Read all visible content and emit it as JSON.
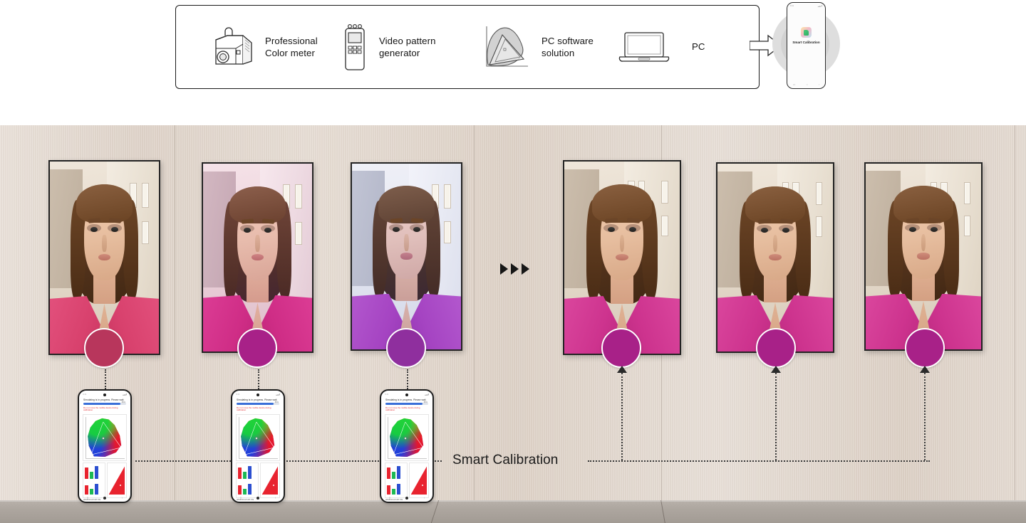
{
  "top_diagram": {
    "equipment": [
      {
        "id": "color-meter",
        "icon": "color-meter-icon",
        "label": "Professional\nColor meter"
      },
      {
        "id": "pattern-generator",
        "icon": "pattern-generator-icon",
        "label": "Video pattern\ngenerator"
      },
      {
        "id": "pc-software",
        "icon": "cie-gamut-icon",
        "label": "PC software\nsolution"
      },
      {
        "id": "pc",
        "icon": "laptop-icon",
        "label": "PC"
      }
    ],
    "flow_arrow_icon": "right-arrow-icon",
    "hero_phone": {
      "status_left": "9:41",
      "status_right": "",
      "app_icon": "smart-calibration-app-icon",
      "app_label": "Smart\nCalibration",
      "nav": [
        "□",
        "○",
        "‹"
      ]
    }
  },
  "scene": {
    "flow_arrows_icon": "triple-play-arrows-icon",
    "caption": "Smart Calibration",
    "uncalibrated_displays": [
      {
        "id": "display-1",
        "swatch_color": "#b8365c",
        "tint": "none",
        "label": "uncalibrated-display-1"
      },
      {
        "id": "display-2",
        "swatch_color": "#a82188",
        "tint": "magenta",
        "label": "uncalibrated-display-2"
      },
      {
        "id": "display-3",
        "swatch_color": "#8f2f9e",
        "tint": "purple",
        "label": "uncalibrated-display-3"
      }
    ],
    "calibrated_displays": [
      {
        "id": "display-4",
        "swatch_color": "#a82188",
        "label": "calibrated-display-1"
      },
      {
        "id": "display-5",
        "swatch_color": "#a82188",
        "label": "calibrated-display-2"
      },
      {
        "id": "display-6",
        "swatch_color": "#a82188",
        "label": "calibrated-display-3"
      }
    ],
    "phones": [
      {
        "id": "phone-1",
        "status_left": "9:41",
        "title": "Simulating is in progress. Please wait.",
        "progress_value": "86%",
        "warning": "Do not move the mobile device during calibration",
        "legend": "sRGB   DCI-P3   BT.709"
      },
      {
        "id": "phone-2",
        "status_left": "9:41",
        "title": "Simulating is in progress. Please wait.",
        "progress_value": "86%",
        "warning": "Do not move the mobile device during calibration",
        "legend": "sRGB   DCI-P3   BT.709"
      },
      {
        "id": "phone-3",
        "status_left": "9:41",
        "title": "Simulating is in progress. Please wait.",
        "progress_value": "86%",
        "warning": "Do not move the mobile device during calibration",
        "legend": "sRGB   DCI-P3   BT.709"
      }
    ],
    "colors": {
      "wall": "#e1d6cb",
      "floor": "#aea7a0",
      "bezel": "#232323",
      "accent_magenta": "#a82188",
      "warning_red": "#e0262b",
      "progress_blue": "#3a6fd8"
    }
  }
}
